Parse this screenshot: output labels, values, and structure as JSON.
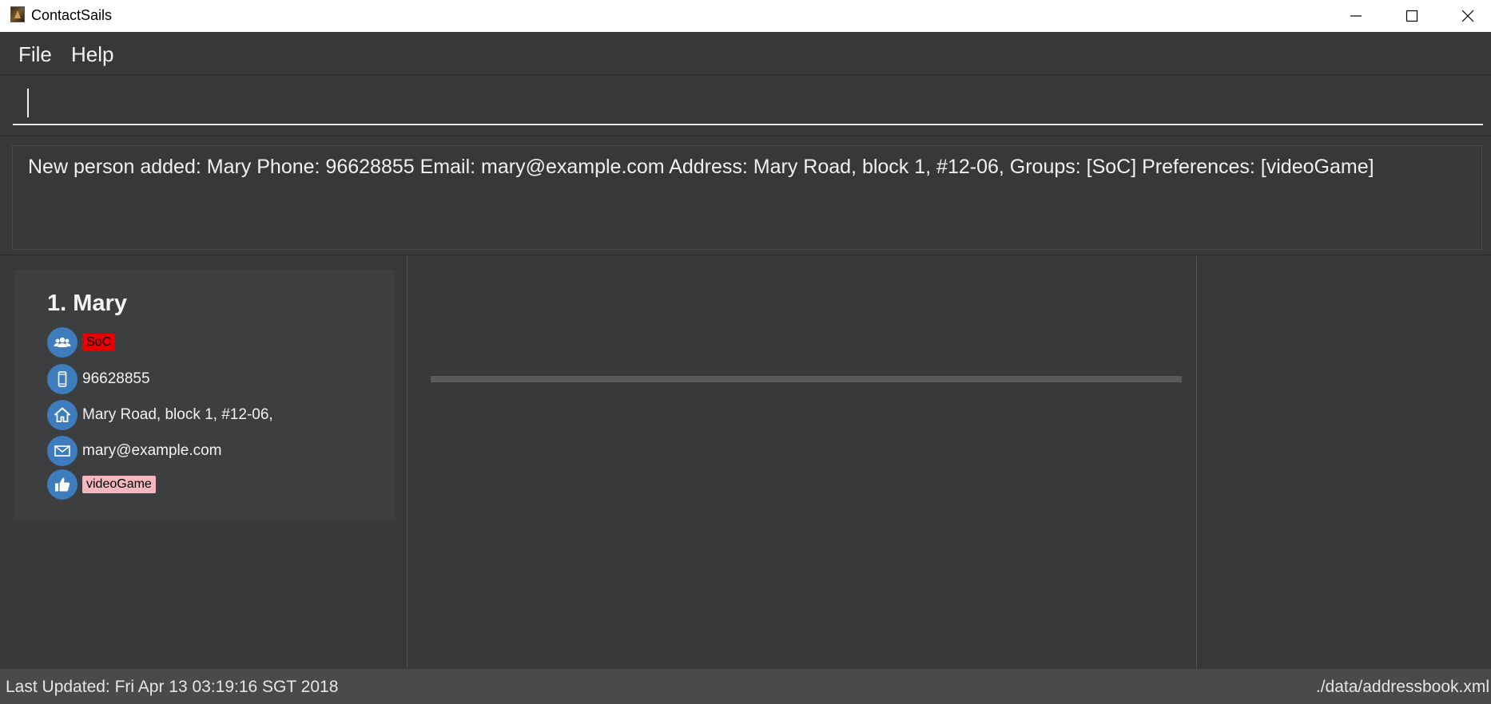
{
  "window": {
    "title": "ContactSails"
  },
  "menu": {
    "file": "File",
    "help": "Help"
  },
  "command": {
    "value": ""
  },
  "result": {
    "message": "New person added: Mary Phone: 96628855 Email: mary@example.com Address: Mary Road, block 1, #12-06, Groups: [SoC] Preferences: [videoGame]"
  },
  "person": {
    "index_name": "1.  Mary",
    "group_tag": "SoC",
    "phone": "96628855",
    "address": "Mary Road, block 1, #12-06,",
    "email": "mary@example.com",
    "preference_tag": "videoGame"
  },
  "status": {
    "last_updated": "Last Updated: Fri Apr 13 03:19:16 SGT 2018",
    "file_path": "./data/addressbook.xml"
  },
  "icons": {
    "group": "group-icon",
    "phone": "phone-icon",
    "address": "home-icon",
    "email": "envelope-icon",
    "preference": "thumbs-up-icon"
  },
  "colors": {
    "background": "#383838",
    "icon_circle": "#3d7dbd",
    "group_tag": "#e60000",
    "preference_tag": "#f4b6bf"
  }
}
